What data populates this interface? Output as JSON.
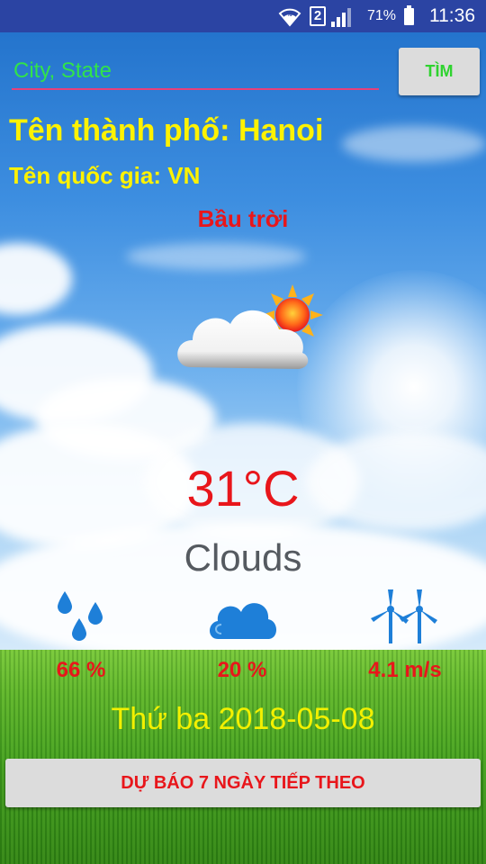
{
  "status_bar": {
    "time": "11:36",
    "battery_percent": "71%",
    "sim_slot": "2",
    "icons": [
      "wifi-icon",
      "sim-icon",
      "signal-icon",
      "battery-icon"
    ]
  },
  "search": {
    "placeholder": "City, State",
    "value": "",
    "button_label": "TÌM"
  },
  "location": {
    "city_text": "Tên thành phố: Hanoi",
    "country_text": "Tên quốc gia: VN"
  },
  "weather": {
    "description_vi": "Bầu trời",
    "icon": "partly-cloudy-sun-icon",
    "temperature": "31°C",
    "main": "Clouds"
  },
  "stats": {
    "humidity": "66 %",
    "cloudiness": "20 %",
    "wind": "4.1 m/s"
  },
  "date_text": "Thứ ba 2018-05-08",
  "forecast_button_label": "DỰ BÁO 7 NGÀY TIẾP THEO",
  "colors": {
    "status_bar": "#2b44a3",
    "accent_yellow": "#fff200",
    "accent_red": "#e8161b",
    "accent_green": "#31e34a",
    "stat_icon_blue": "#1e7fd8"
  }
}
